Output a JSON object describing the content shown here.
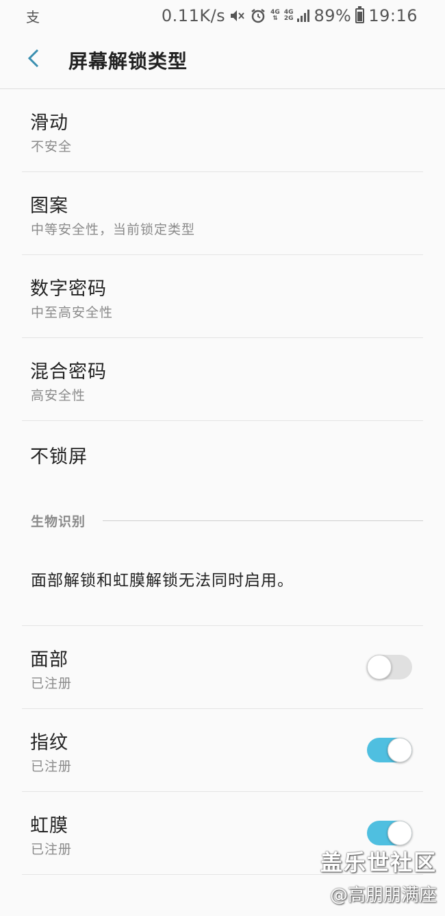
{
  "status_bar": {
    "carrier_glyph": "支",
    "net_speed": "0.11K/s",
    "battery": "89%",
    "battery_level": 0.89,
    "time": "19:16",
    "sig1": "4G",
    "sig2_top": "4G",
    "sig2_bot": "2G"
  },
  "header": {
    "title": "屏幕解锁类型"
  },
  "lock_types": [
    {
      "title": "滑动",
      "subtitle": "不安全"
    },
    {
      "title": "图案",
      "subtitle": "中等安全性，当前锁定类型"
    },
    {
      "title": "数字密码",
      "subtitle": "中至高安全性"
    },
    {
      "title": "混合密码",
      "subtitle": "高安全性"
    },
    {
      "title": "不锁屏"
    }
  ],
  "biometrics": {
    "section_label": "生物识别",
    "note": "面部解锁和虹膜解锁无法同时启用。",
    "items": [
      {
        "title": "面部",
        "subtitle": "已注册",
        "enabled": false
      },
      {
        "title": "指纹",
        "subtitle": "已注册",
        "enabled": true
      },
      {
        "title": "虹膜",
        "subtitle": "已注册",
        "enabled": true
      }
    ]
  },
  "watermark": {
    "line1": "盖乐世社区",
    "line2": "@高朋朋满座"
  },
  "colors": {
    "accent": "#4fbfe0",
    "back_arrow": "#3a8fb0"
  }
}
